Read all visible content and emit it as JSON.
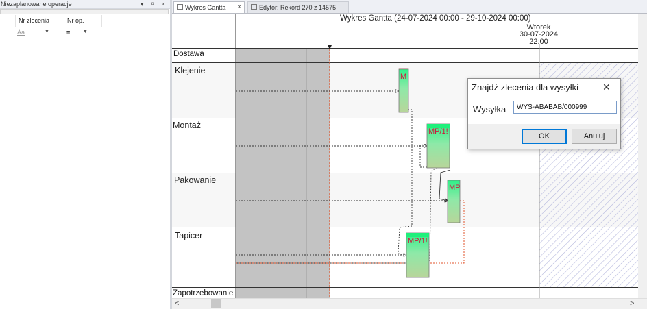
{
  "left_panel": {
    "title": "Niezaplanowane operacje",
    "title_icons": [
      "dropdown-arrow-icon",
      "pin-icon",
      "close-icon"
    ],
    "pin_glyph": "ᵖ",
    "columns": [
      {
        "label": "Nr zlecenia"
      },
      {
        "label": "Nr op."
      }
    ],
    "filters": [
      {
        "icon": "text-filter-icon",
        "glyph": "Aa"
      },
      {
        "icon": "equals-filter-icon",
        "glyph": "="
      }
    ]
  },
  "tabs": [
    {
      "label": "Wykres Gantta",
      "active": true,
      "close": "×"
    },
    {
      "label": "Edytor: Rekord 270 z 14575",
      "active": false,
      "close": ""
    }
  ],
  "gantt": {
    "title": "Wykres Gantta   (24-07-2024 00:00 - 29-10-2024 00:00)",
    "marker_day": "Wtorek",
    "marker_date": "30-07-2024",
    "marker_time": "22:00",
    "rows": [
      {
        "label": "Dostawa"
      },
      {
        "label": "Klejenie"
      },
      {
        "label": "Montaż"
      },
      {
        "label": "Pakowanie"
      },
      {
        "label": "Tapicer"
      },
      {
        "label": "Zapotrzebowanie"
      }
    ],
    "tasks": [
      {
        "label": "M",
        "row": "Klejenie"
      },
      {
        "label": "MP/1!",
        "row": "Montaż"
      },
      {
        "label": "MP",
        "row": "Pakowanie"
      },
      {
        "label": "MP/1!",
        "row": "Tapicer"
      }
    ],
    "colors": {
      "nonworking": "#c3c3c3",
      "now_line": "#e0532b",
      "task_top": "#34f08a",
      "task_bottom": "#a9c979",
      "task_label": "#d0143c",
      "hatch": "#b5b8dd"
    }
  },
  "dialog": {
    "title": "Znajdź zlecenia dla wysyłki",
    "field_label": "Wysyłka",
    "field_value": "WYS-ABABAB/000999",
    "ok_label": "OK",
    "cancel_label": "Anuluj"
  },
  "scrollbar": {
    "left_arrow": "<",
    "right_arrow": ">",
    "up_arrow": "^",
    "down_arrow": "v"
  }
}
